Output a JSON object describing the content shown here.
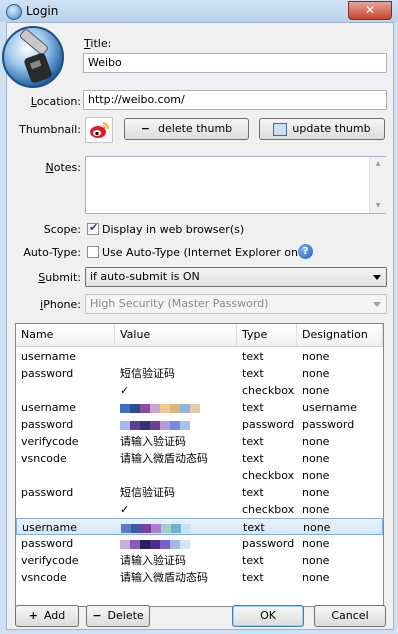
{
  "window": {
    "title": "Login",
    "close_glyph": "✕"
  },
  "form": {
    "title_label_pre": "",
    "title_label_u": "T",
    "title_label_post": "itle:",
    "title_value": "Weibo",
    "location_label_pre": "",
    "location_label_u": "L",
    "location_label_post": "ocation:",
    "location_value": "http://weibo.com/",
    "thumbnail_label": "Thumbnail:",
    "delete_thumb_label": "delete thumb",
    "update_thumb_label": "update thumb",
    "notes_label_pre": "",
    "notes_label_u": "N",
    "notes_label_post": "otes:",
    "notes_value": "",
    "scope_label": "Scope:",
    "scope_checkbox_label": "Display in web browser(s)",
    "scope_checked": true,
    "autotype_label": "Auto-Type:",
    "autotype_checkbox_label": "Use Auto-Type (Internet Explorer only)",
    "autotype_checked": false,
    "submit_label_pre": "",
    "submit_label_u": "S",
    "submit_label_post": "ubmit:",
    "submit_value": "if auto-submit is ON",
    "iphone_label_pre": "",
    "iphone_label_u": "i",
    "iphone_label_post": "Phone:",
    "iphone_value": "High Security (Master Password)"
  },
  "table": {
    "columns": [
      "Name",
      "Value",
      "Type",
      "Designation"
    ],
    "rows": [
      {
        "name": "username",
        "value": "",
        "type": "text",
        "designation": "none"
      },
      {
        "name": "password",
        "value": "短信验证码",
        "type": "text",
        "designation": "none"
      },
      {
        "name": "",
        "value": "✓",
        "type": "checkbox",
        "designation": "none"
      },
      {
        "name": "username",
        "value": "",
        "type": "text",
        "designation": "username"
      },
      {
        "name": "password",
        "value": "",
        "type": "password",
        "designation": "password"
      },
      {
        "name": "verifycode",
        "value": "请输入验证码",
        "type": "text",
        "designation": "none"
      },
      {
        "name": "vsncode",
        "value": "请输入微盾动态码",
        "type": "text",
        "designation": "none"
      },
      {
        "name": "",
        "value": "",
        "type": "checkbox",
        "designation": "none"
      },
      {
        "name": "password",
        "value": "短信验证码",
        "type": "text",
        "designation": "none"
      },
      {
        "name": "",
        "value": "✓",
        "type": "checkbox",
        "designation": "none"
      },
      {
        "name": "username",
        "value": "",
        "type": "text",
        "designation": "none"
      },
      {
        "name": "password",
        "value": "",
        "type": "password",
        "designation": "none"
      },
      {
        "name": "verifycode",
        "value": "请输入验证码",
        "type": "text",
        "designation": "none"
      },
      {
        "name": "vsncode",
        "value": "请输入微盾动态码",
        "type": "text",
        "designation": "none"
      }
    ],
    "selected_index": 10
  },
  "buttons": {
    "add": "Add",
    "delete": "Delete",
    "ok": "OK",
    "cancel": "Cancel",
    "add_glyph": "+",
    "delete_glyph": "−",
    "minus_glyph": "−"
  },
  "icons": {
    "help": "?",
    "scrollbar_up": "▲",
    "scrollbar_down": "▼"
  },
  "colors": {
    "accent": "#3c7fb1",
    "selected_row": "#d4e7fb"
  }
}
